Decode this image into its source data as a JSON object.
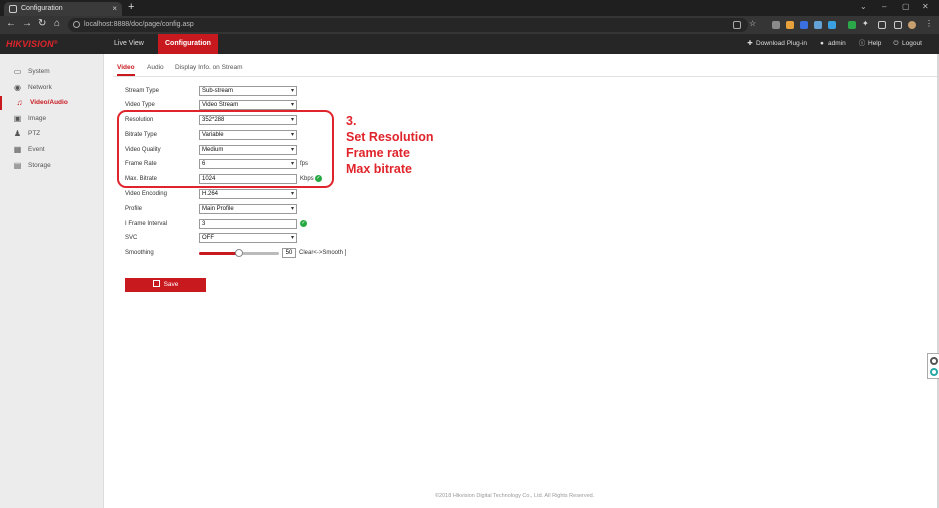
{
  "browser": {
    "tab_title": "Configuration",
    "tab_close": "×",
    "new_tab": "+",
    "url": "localhost:8888/doc/page/config.asp",
    "back": "←",
    "forward": "→",
    "reload": "↻",
    "home": "⌂"
  },
  "app": {
    "logo": "HIKVISION",
    "logo_mark": "®",
    "nav": [
      {
        "label": "Live View"
      },
      {
        "label": "Configuration"
      }
    ],
    "header_right": {
      "download": "Download Plug-in",
      "user": "admin",
      "help": "Help",
      "logout": "Logout"
    }
  },
  "sidebar": {
    "items": [
      {
        "label": "System",
        "icon": "monitor-icon"
      },
      {
        "label": "Network",
        "icon": "globe-icon"
      },
      {
        "label": "Video/Audio",
        "icon": "video-audio-icon"
      },
      {
        "label": "Image",
        "icon": "image-icon"
      },
      {
        "label": "PTZ",
        "icon": "person-icon"
      },
      {
        "label": "Event",
        "icon": "calendar-icon"
      },
      {
        "label": "Storage",
        "icon": "storage-icon"
      }
    ]
  },
  "subtabs": [
    {
      "label": "Video"
    },
    {
      "label": "Audio"
    },
    {
      "label": "Display Info. on Stream"
    }
  ],
  "form": {
    "stream_type": {
      "label": "Stream Type",
      "value": "Sub-stream"
    },
    "video_type": {
      "label": "Video Type",
      "value": "Video Stream"
    },
    "resolution": {
      "label": "Resolution",
      "value": "352*288"
    },
    "bitrate_type": {
      "label": "Bitrate Type",
      "value": "Variable"
    },
    "video_quality": {
      "label": "Video Quality",
      "value": "Medium"
    },
    "frame_rate": {
      "label": "Frame Rate",
      "value": "6",
      "unit": "fps"
    },
    "max_bitrate": {
      "label": "Max. Bitrate",
      "value": "1024",
      "unit": "Kbps"
    },
    "video_encoding": {
      "label": "Video Encoding",
      "value": "H.264"
    },
    "profile": {
      "label": "Profile",
      "value": "Main Profile"
    },
    "i_frame_interval": {
      "label": "I Frame Interval",
      "value": "3"
    },
    "svc": {
      "label": "SVC",
      "value": "OFF"
    },
    "smoothing": {
      "label": "Smoothing",
      "value": "50",
      "hint": "Clear<->Smooth ]",
      "level": 0.5
    },
    "save_label": "Save",
    "caret": "▾",
    "check": "✓"
  },
  "annotation": {
    "step": "3.",
    "line1": "Set Resolution",
    "line2": "Frame rate",
    "line3": "Max bitrate",
    "color": "#e0242b"
  },
  "footer": "©2018 Hikvision Digital Technology Co., Ltd. All Rights Reserved.",
  "colors": {
    "accent": "#c8191f",
    "header": "#262626",
    "ok": "#27a942"
  }
}
